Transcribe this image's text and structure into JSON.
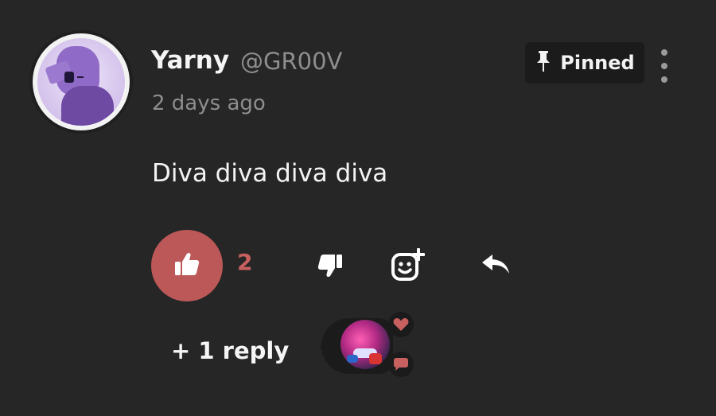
{
  "comment": {
    "username": "Yarny",
    "handle": "@GR00V",
    "timestamp": "2 days ago",
    "pinned_label": "Pinned",
    "text": "Diva diva diva diva",
    "like_count": "2",
    "replies_label": "+ 1 reply"
  },
  "icons": {
    "pin": "pin-icon",
    "more": "more-vertical-icon",
    "like": "thumbs-up-icon",
    "dislike": "thumbs-down-icon",
    "reaction": "add-reaction-icon",
    "reply": "reply-icon",
    "heart": "heart-icon",
    "chat": "chat-bubble-icon"
  },
  "colors": {
    "background": "#262626",
    "accent": "#bd5858",
    "like_count": "#c96060",
    "muted_text": "#8e8e8e",
    "badge_bg": "#1b1b1b"
  }
}
